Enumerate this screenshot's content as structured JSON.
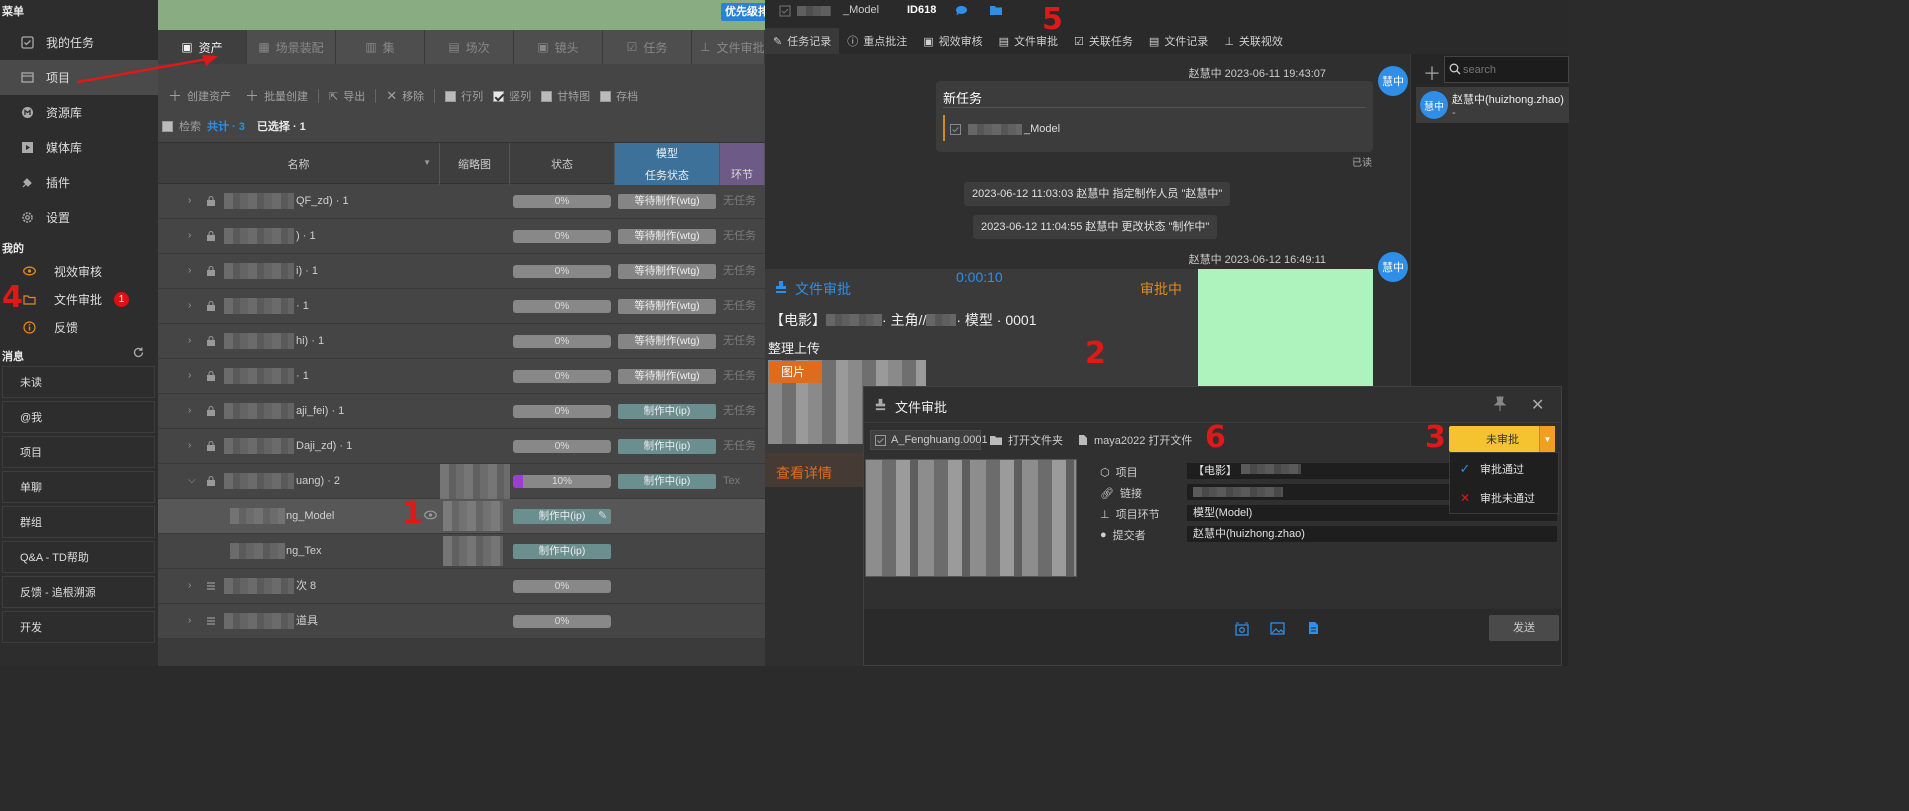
{
  "sidebar": {
    "menu_title": "菜单",
    "menu_items": [
      {
        "label": "我的任务",
        "icon": "task-icon"
      },
      {
        "label": "项目",
        "icon": "project-icon"
      },
      {
        "label": "资源库",
        "icon": "library-icon"
      },
      {
        "label": "媒体库",
        "icon": "media-icon"
      },
      {
        "label": "插件",
        "icon": "plugin-icon"
      },
      {
        "label": "设置",
        "icon": "gear-icon"
      }
    ],
    "my_title": "我的",
    "my_items": [
      {
        "label": "视效审核",
        "icon": "eye-icon"
      },
      {
        "label": "文件审批",
        "icon": "folder-icon",
        "badge": "1"
      },
      {
        "label": "反馈",
        "icon": "info-icon"
      }
    ],
    "msg_title": "消息",
    "msg_items": [
      "未读",
      "@我",
      "项目",
      "单聊",
      "群组",
      "Q&A - TD帮助",
      "反馈 - 追根溯源",
      "开发"
    ]
  },
  "middle": {
    "priority_label": "优先级排",
    "tabs": [
      "资产",
      "场景装配",
      "集",
      "场次",
      "镜头",
      "任务",
      "文件审批"
    ],
    "toolbar": [
      "创建资产",
      "批量创建",
      "导出",
      "移除",
      "行列",
      "竖列",
      "甘特图",
      "存档"
    ],
    "search_label": "检索",
    "count_label": "共计 · 3",
    "selected_label": "已选择 · 1",
    "columns": {
      "name": "名称",
      "thumb": "缩略图",
      "status": "状态",
      "model": "模型",
      "model_sub": "任务状态",
      "stage": "环节"
    },
    "rows": [
      {
        "name": "QF_zd) · 1",
        "progress": "0%",
        "status": "等待制作(wtg)",
        "task": "无任务"
      },
      {
        "name": ") · 1",
        "progress": "0%",
        "status": "等待制作(wtg)",
        "task": "无任务"
      },
      {
        "name": "i) · 1",
        "progress": "0%",
        "status": "等待制作(wtg)",
        "task": "无任务"
      },
      {
        "name": "· 1",
        "progress": "0%",
        "status": "等待制作(wtg)",
        "task": "无任务"
      },
      {
        "name": "hi) · 1",
        "progress": "0%",
        "status": "等待制作(wtg)",
        "task": "无任务"
      },
      {
        "name": "· 1",
        "progress": "0%",
        "status": "等待制作(wtg)",
        "task": "无任务"
      },
      {
        "name": "aji_fei) · 1",
        "progress": "0%",
        "status": "制作中(ip)",
        "task": "无任务"
      },
      {
        "name": "Daji_zd) · 1",
        "progress": "0%",
        "status": "制作中(ip)",
        "task": "无任务"
      },
      {
        "name": "uang) · 2",
        "progress": "10%",
        "status": "制作中(ip)",
        "task": "Tex"
      },
      {
        "name": "ng_Model",
        "progress": "制作中(ip)",
        "status": "",
        "task": ""
      },
      {
        "name": "ng_Tex",
        "progress": "制作中(ip)",
        "status": "",
        "task": ""
      },
      {
        "name": "次 8",
        "progress": "0%",
        "status": "",
        "task": ""
      },
      {
        "name": "道具",
        "progress": "0%",
        "status": "",
        "task": ""
      }
    ]
  },
  "right": {
    "top_title": "_Model",
    "top_id": "ID618",
    "tabs": [
      "任务记录",
      "重点批注",
      "视效审核",
      "文件审批",
      "关联任务",
      "文件记录",
      "关联视效"
    ],
    "search_placeholder": "search",
    "contact": {
      "name": "赵慧中(huizhong.zhao)",
      "sub": "-",
      "avatar": "慧中"
    },
    "chat": {
      "msg1_meta": "赵慧中 2023-06-11 19:43:07",
      "msg1_title": "新任务",
      "msg1_item": "_Model",
      "msg1_read": "已读",
      "sys1": "2023-06-12 11:03:03 赵慧中 指定制作人员 \"赵慧中\"",
      "sys2": "2023-06-12 11:04:55 赵慧中 更改状态 \"制作中\"",
      "msg2_meta": "赵慧中 2023-06-12 16:49:11",
      "card_title": "文件审批",
      "card_time": "0:00:10",
      "card_status": "审批中",
      "card_film_a": "【电影】",
      "card_film_b": "· 主角//",
      "card_film_c": "· 模型 · 0001",
      "card_desc": "整理上传",
      "card_img_tag": "图片",
      "card_more": "查看详情",
      "avatar": "慧中"
    }
  },
  "dialog": {
    "title": "文件审批",
    "file_name": "A_Fenghuang.0001",
    "open_folder": "打开文件夹",
    "open_file": "maya2022 打开文件",
    "fields": [
      {
        "label": "项目",
        "value": "【电影】"
      },
      {
        "label": "链接",
        "value": ""
      },
      {
        "label": "项目环节",
        "value": "模型(Model)"
      },
      {
        "label": "提交者",
        "value": "赵慧中(huizhong.zhao)"
      }
    ],
    "status_button": "未审批",
    "menu": [
      "审批通过",
      "审批未通过"
    ],
    "send": "发送"
  },
  "annotations": [
    "1",
    "2",
    "3",
    "4",
    "5",
    "6"
  ],
  "colors": {
    "accent_blue": "#2e8ee8",
    "orange": "#e06b1c",
    "yellow": "#f5c230",
    "red_annotation": "#e01818"
  }
}
